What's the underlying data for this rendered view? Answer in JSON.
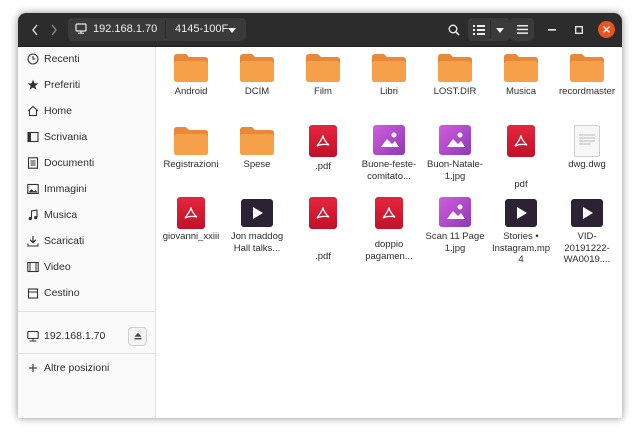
{
  "header": {
    "path": [
      "192.168.1.70",
      "4145-100F"
    ],
    "back_icon": "chevron-left-icon",
    "forward_icon": "chevron-right-icon"
  },
  "sidebar": {
    "items": [
      {
        "label": "Recenti",
        "icon": "clock-icon"
      },
      {
        "label": "Preferiti",
        "icon": "star-icon"
      },
      {
        "label": "Home",
        "icon": "home-icon"
      },
      {
        "label": "Scrivania",
        "icon": "desktop-icon"
      },
      {
        "label": "Documenti",
        "icon": "document-icon"
      },
      {
        "label": "Immagini",
        "icon": "image-icon"
      },
      {
        "label": "Musica",
        "icon": "music-icon"
      },
      {
        "label": "Scaricati",
        "icon": "download-icon"
      },
      {
        "label": "Video",
        "icon": "video-icon"
      },
      {
        "label": "Cestino",
        "icon": "trash-icon"
      }
    ],
    "network": {
      "label": "192.168.1.70",
      "icon": "network-drive-icon"
    },
    "other": {
      "label": "Altre posizioni",
      "icon": "plus-icon"
    }
  },
  "files": [
    {
      "name": "Android",
      "type": "folder"
    },
    {
      "name": "DCIM",
      "type": "folder"
    },
    {
      "name": "Film",
      "type": "folder"
    },
    {
      "name": "Libri",
      "type": "folder"
    },
    {
      "name": "LOST.DIR",
      "type": "folder"
    },
    {
      "name": "Musica",
      "type": "folder"
    },
    {
      "name": "recordmaster",
      "type": "folder"
    },
    {
      "name": "Registrazioni",
      "type": "folder"
    },
    {
      "name": "Spese",
      "type": "folder"
    },
    {
      "name": ".pdf",
      "type": "pdf"
    },
    {
      "name": "Buone-feste-comitato...",
      "type": "image"
    },
    {
      "name": "Buon-Natale-1.jpg",
      "type": "image"
    },
    {
      "name": "pdf",
      "type": "pdf"
    },
    {
      "name": "dwg.dwg",
      "type": "document"
    },
    {
      "name": "giovanni_xxiii",
      "type": "pdf"
    },
    {
      "name": "Jon maddog Hall talks...",
      "type": "video"
    },
    {
      "name": ".pdf",
      "type": "pdf"
    },
    {
      "name": "doppio pagamen...",
      "type": "pdf"
    },
    {
      "name": "Scan 11 Page 1.jpg",
      "type": "image"
    },
    {
      "name": "Stories • Instagram.mp4",
      "type": "video"
    },
    {
      "name": "VID-20191222-WA0019....",
      "type": "video"
    }
  ],
  "colors": {
    "accent": "#e95420",
    "folder": "#f7a04a",
    "pdf": "#d61b33",
    "image": "#b64ccb"
  }
}
